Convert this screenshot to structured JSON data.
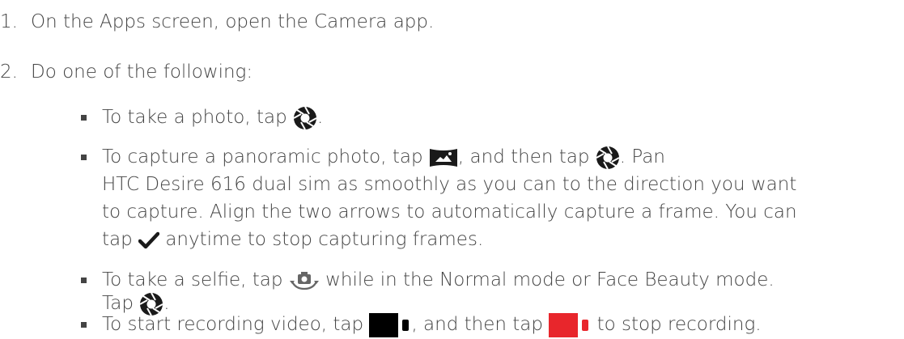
{
  "steps": [
    {
      "num": "1.",
      "text": "On the Apps screen, open the Camera app."
    },
    {
      "num": "2.",
      "text": "Do one of the following:"
    }
  ],
  "bullets": {
    "photo": {
      "pre": "To take a photo, tap ",
      "post": "."
    },
    "panorama": {
      "pre": "To capture a panoramic photo, tap ",
      "mid": ", and then tap ",
      "post": ". Pan",
      "line2": "HTC Desire 616 dual sim as smoothly as you can to the direction you want",
      "line3": "to capture. Align the two arrows to automatically capture a frame. You can",
      "line4_pre": "tap ",
      "line4_post": " anytime to stop capturing frames."
    },
    "selfie": {
      "pre": "To take a selfie, tap ",
      "post": " while in the Normal mode or Face Beauty mode.",
      "line2_pre": "Tap ",
      "line2_post": "."
    },
    "video": {
      "pre": "To start recording video, tap ",
      "mid": ", and then tap ",
      "post": " to stop recording."
    }
  },
  "icons": {
    "shutter": "camera-shutter-icon",
    "panorama": "panorama-mode-icon",
    "checkmark": "checkmark-icon",
    "switch_camera": "switch-camera-icon",
    "record": "video-record-icon",
    "stop": "video-stop-icon"
  },
  "colors": {
    "text": "#444444",
    "stop_red": "#e8262c",
    "record_black": "#000000"
  }
}
